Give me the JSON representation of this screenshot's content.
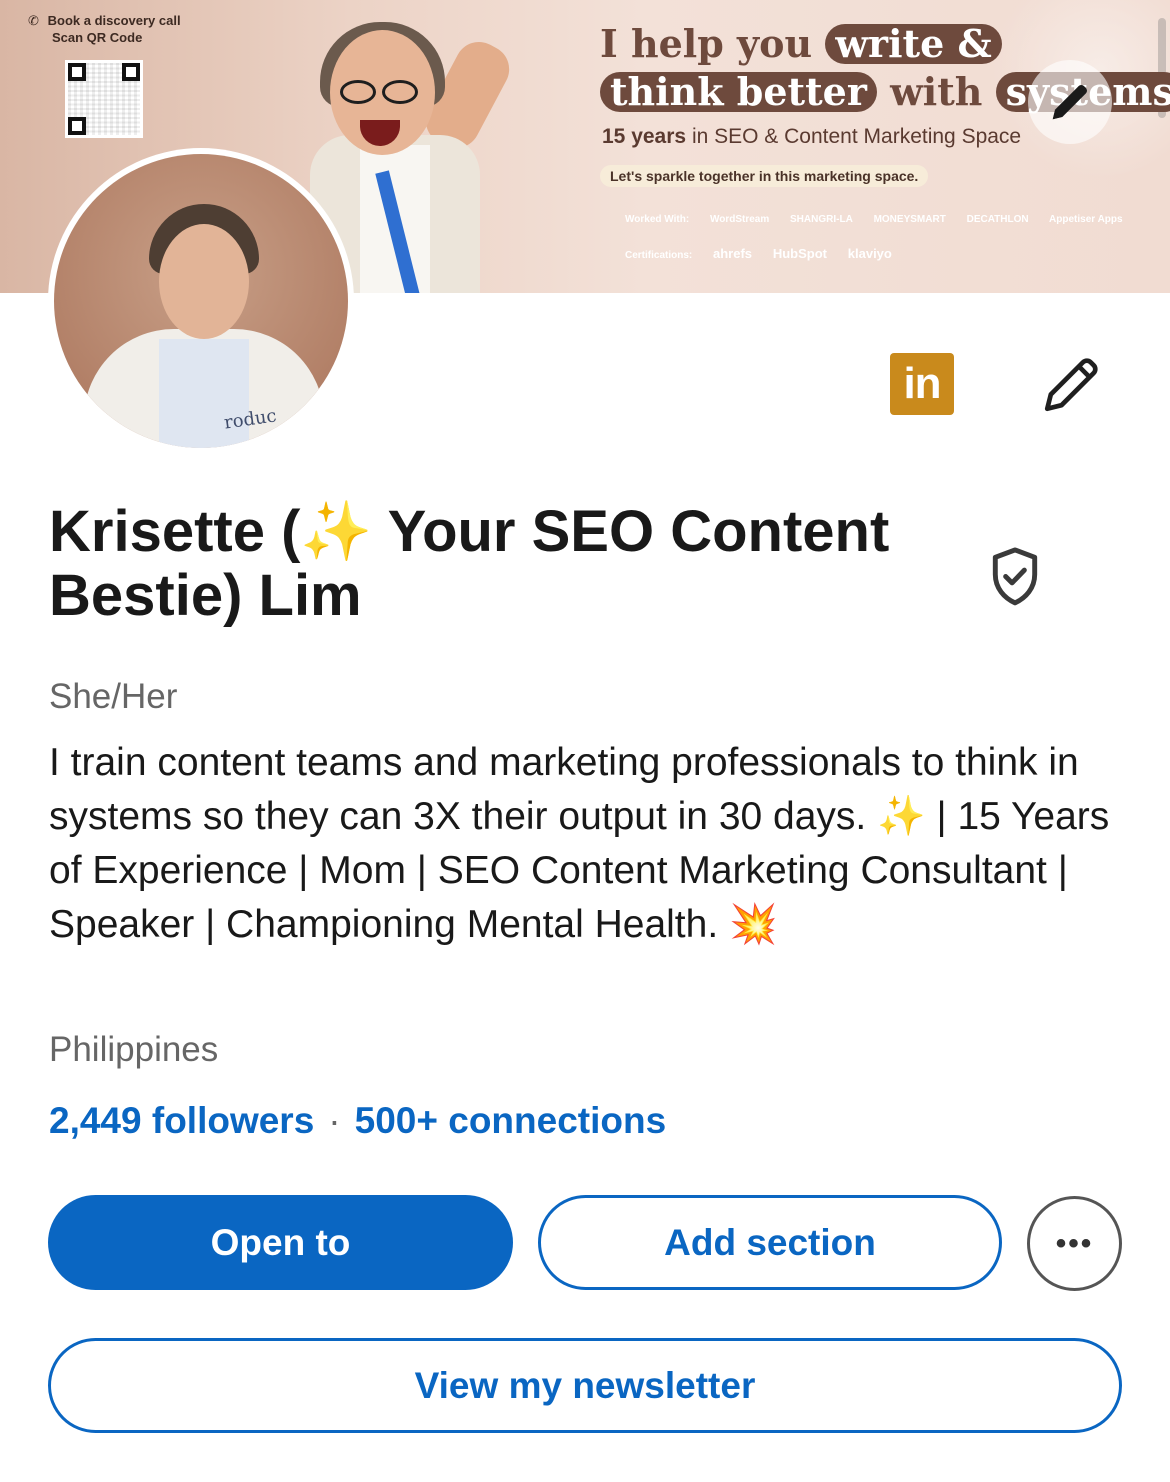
{
  "banner": {
    "book_call": "Book a discovery call",
    "scan_qr": "Scan QR Code",
    "headline_part1": "I help you",
    "headline_pill1": "write &",
    "headline_pill2": "think better",
    "headline_part2": "with",
    "headline_pill3": "systems",
    "years_bold": "15 years",
    "years_rest": "in SEO & Content Marketing Space",
    "sparkle_tag": "Let's sparkle together in this marketing space.",
    "worked_with_label": "Worked With:",
    "worked_with": [
      "WordStream",
      "SHANGRI-LA",
      "MONEYSMART",
      "DECATHLON",
      "Appetiser Apps"
    ],
    "certifications_label": "Certifications:",
    "certifications": [
      "ahrefs",
      "HubSpot",
      "klaviyo"
    ]
  },
  "profile": {
    "linkedin_logo": "in",
    "name": "Krisette (✨ Your SEO Content Bestie) Lim",
    "pronouns": "She/Her",
    "headline": "I train content teams and marketing professionals to think in systems so they can 3X their output in 30 days.  ✨ | 15 Years of Experience | Mom | SEO Content Marketing Consultant | Speaker | Championing Mental Health. 💥",
    "location": "Philippines",
    "followers": "2,449 followers",
    "separator": "·",
    "connections": "500+ connections"
  },
  "actions": {
    "open_to": "Open to",
    "add_section": "Add section",
    "more": "•••",
    "view_newsletter": "View my newsletter"
  },
  "colors": {
    "linkedin_blue": "#0a66c2",
    "banner_brown": "#6e4a3d",
    "logo_gold": "#c98a1c"
  },
  "icons": {
    "banner_edit": "pencil-icon",
    "profile_edit": "pencil-icon",
    "verified": "shield-check-icon",
    "phone": "phone-icon"
  }
}
